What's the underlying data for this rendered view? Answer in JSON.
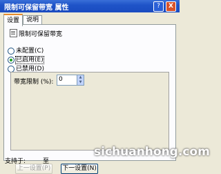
{
  "window": {
    "title": "限制可保留带宽 属性",
    "help_label": "?",
    "close_label": "X"
  },
  "tabs": [
    {
      "label": "设置",
      "active": true
    },
    {
      "label": "说明",
      "active": false
    }
  ],
  "policy": {
    "name": "限制可保留带宽"
  },
  "radios": [
    {
      "label": "未配置(C)",
      "checked": false
    },
    {
      "label": "已启用(E)",
      "checked": true
    },
    {
      "label": "已禁用(D)",
      "checked": false
    }
  ],
  "options": {
    "bandwidth_label": "带宽限制 (%):",
    "bandwidth_value": "0"
  },
  "support": {
    "label": "支持于:",
    "value": "至"
  },
  "buttons": {
    "prev": "上一设置(P)",
    "next": "下一设置(N)"
  },
  "watermark": "sichuanhong.com"
}
